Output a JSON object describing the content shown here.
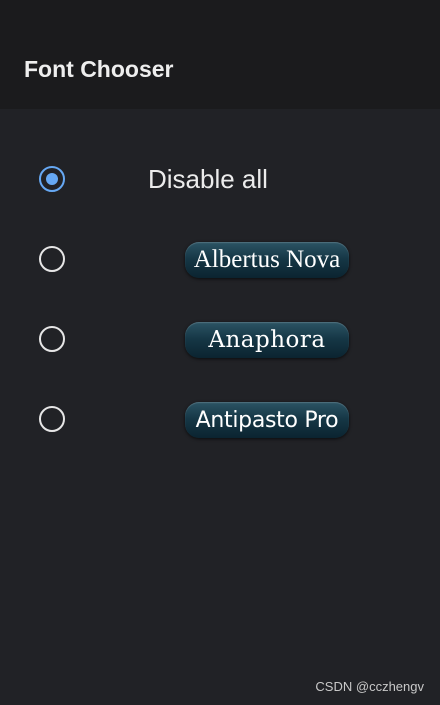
{
  "app_bar": {
    "title": "Font Chooser"
  },
  "options": [
    {
      "label": "Disable all",
      "selected": true
    },
    {
      "label": "Albertus Nova",
      "selected": false
    },
    {
      "label": "Anaphora",
      "selected": false
    },
    {
      "label": "Antipasto Pro",
      "selected": false
    }
  ],
  "watermark": "CSDN @cczhengv",
  "colors": {
    "background": "#212226",
    "app_bar": "#1b1b1d",
    "radio_selected": "#66a8f3",
    "pill_gradient_top": "#2c5464",
    "pill_gradient_bottom": "#0b2430"
  }
}
